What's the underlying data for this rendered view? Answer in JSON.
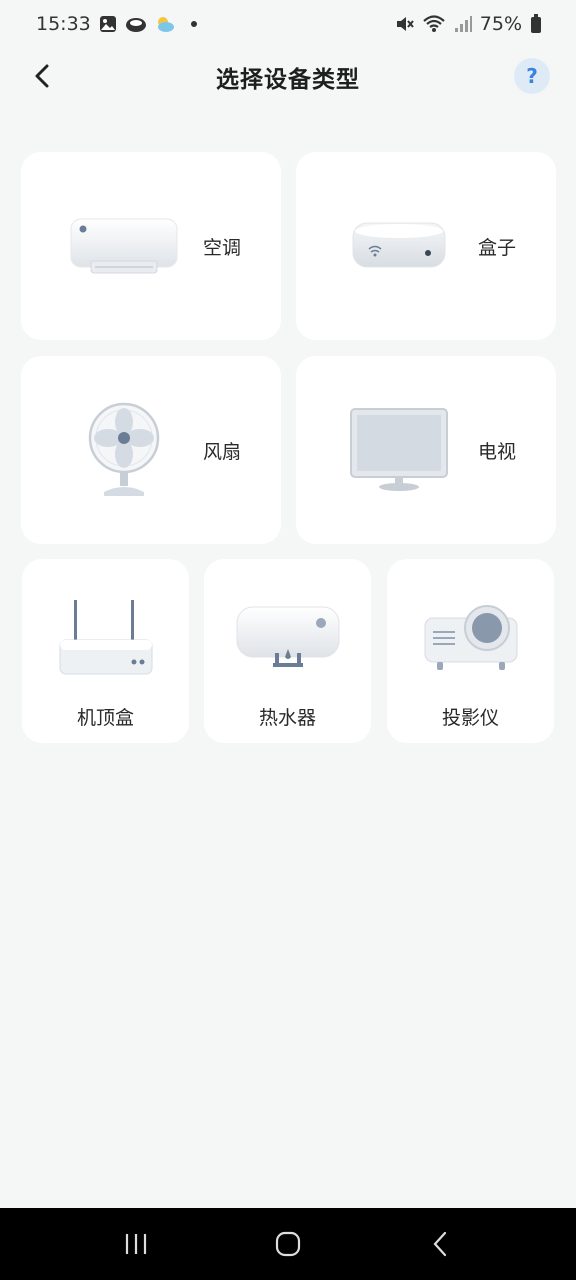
{
  "status_bar": {
    "time": "15:33",
    "battery": "75%",
    "icons": [
      "gallery-icon",
      "cloud-icon",
      "weather-icon",
      "notification-dot",
      "mute-icon",
      "wifi-icon",
      "signal-icon",
      "battery-icon"
    ]
  },
  "header": {
    "title": "选择设备类型",
    "back_icon": "chevron-left-icon",
    "help_label": "?"
  },
  "devices": [
    {
      "label": "空调",
      "icon": "air-conditioner-icon"
    },
    {
      "label": "盒子",
      "icon": "tv-box-icon"
    },
    {
      "label": "风扇",
      "icon": "fan-icon"
    },
    {
      "label": "电视",
      "icon": "television-icon"
    },
    {
      "label": "机顶盒",
      "icon": "router-set-top-box-icon"
    },
    {
      "label": "热水器",
      "icon": "water-heater-icon"
    },
    {
      "label": "投影仪",
      "icon": "projector-icon"
    }
  ],
  "nav_bar": {
    "icons": [
      "recent-apps-icon",
      "home-icon",
      "back-icon"
    ]
  },
  "colors": {
    "background": "#f5f7f7",
    "card": "#ffffff",
    "accent": "#3b82e0",
    "nav_bar": "#000000"
  }
}
